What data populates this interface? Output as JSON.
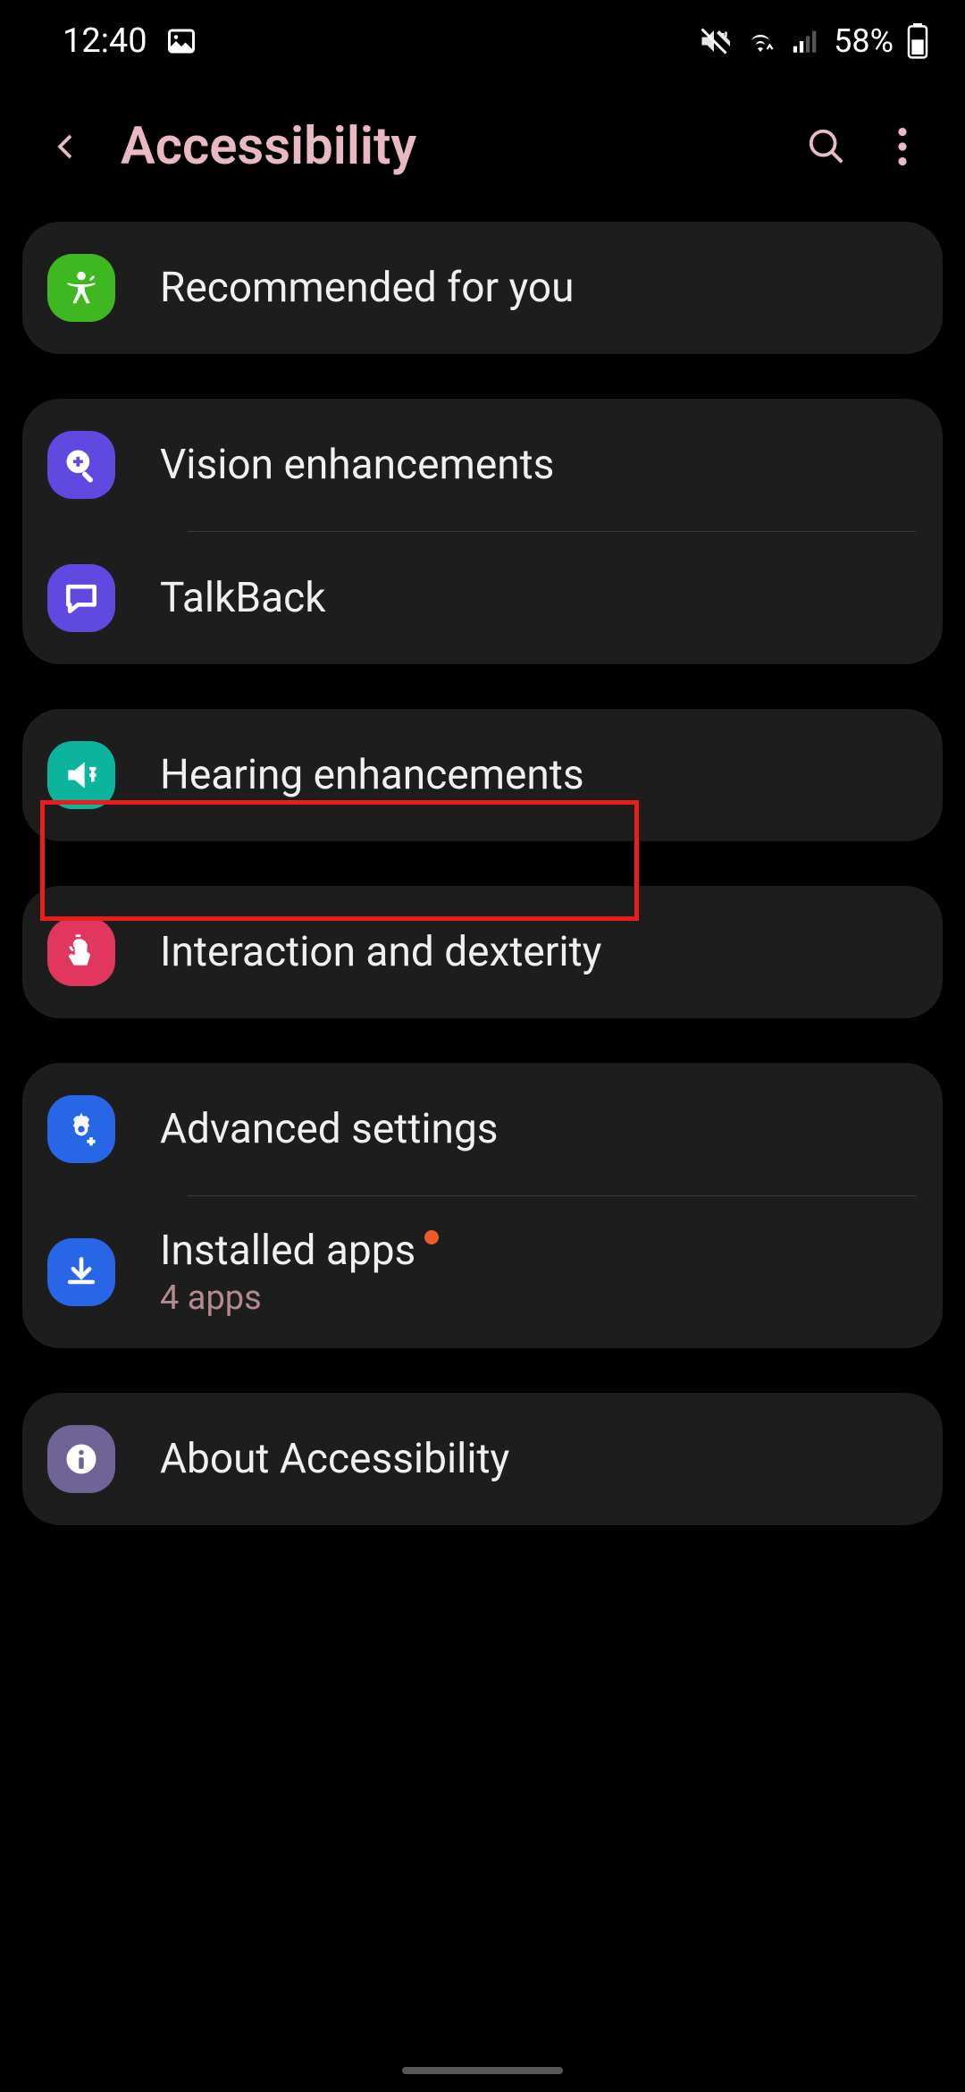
{
  "status": {
    "time": "12:40",
    "battery_pct": "58%"
  },
  "header": {
    "title": "Accessibility"
  },
  "groups": [
    {
      "items": [
        {
          "icon": "person",
          "color": "green",
          "label": "Recommended for you"
        }
      ]
    },
    {
      "items": [
        {
          "icon": "magnify-plus",
          "color": "purple",
          "label": "Vision enhancements"
        },
        {
          "icon": "chat",
          "color": "purple",
          "label": "TalkBack"
        }
      ]
    },
    {
      "items": [
        {
          "icon": "speaker",
          "color": "teal",
          "label": "Hearing enhancements"
        }
      ]
    },
    {
      "items": [
        {
          "icon": "touch",
          "color": "pink",
          "label": "Interaction and dexterity"
        }
      ]
    },
    {
      "items": [
        {
          "icon": "gear-plus",
          "color": "blue",
          "label": "Advanced settings"
        },
        {
          "icon": "download",
          "color": "blue",
          "label": "Installed apps",
          "sublabel": "4 apps",
          "badge": true
        }
      ]
    },
    {
      "items": [
        {
          "icon": "info",
          "color": "lavender",
          "label": "About Accessibility"
        }
      ]
    }
  ],
  "highlight": {
    "target": "hearing-enhancements"
  }
}
